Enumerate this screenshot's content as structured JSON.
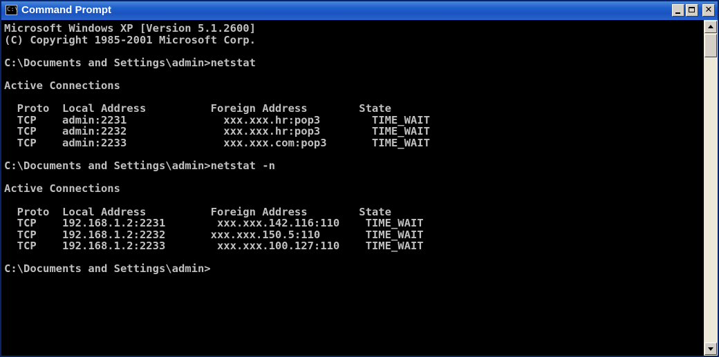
{
  "window": {
    "title": "Command Prompt",
    "icon": "cmd-icon",
    "icon_glyph": "C:\\"
  },
  "console": {
    "lines": [
      "Microsoft Windows XP [Version 5.1.2600]",
      "(C) Copyright 1985-2001 Microsoft Corp.",
      "",
      "C:\\Documents and Settings\\admin>netstat",
      "",
      "Active Connections",
      "",
      "  Proto  Local Address          Foreign Address        State",
      "  TCP    admin:2231               xxx.xxx.hr:pop3        TIME_WAIT",
      "  TCP    admin:2232               xxx.xxx.hr:pop3        TIME_WAIT",
      "  TCP    admin:2233               xxx.xxx.com:pop3       TIME_WAIT",
      "",
      "C:\\Documents and Settings\\admin>netstat -n",
      "",
      "Active Connections",
      "",
      "  Proto  Local Address          Foreign Address        State",
      "  TCP    192.168.1.2:2231        xxx.xxx.142.116:110    TIME_WAIT",
      "  TCP    192.168.1.2:2232       xxx.xxx.150.5:110       TIME_WAIT",
      "  TCP    192.168.1.2:2233        xxx.xxx.100.127:110    TIME_WAIT",
      "",
      "C:\\Documents and Settings\\admin>"
    ]
  },
  "colors": {
    "titlebar": "#1f5fcd",
    "console_bg": "#000000",
    "console_fg": "#c0c0c0"
  }
}
